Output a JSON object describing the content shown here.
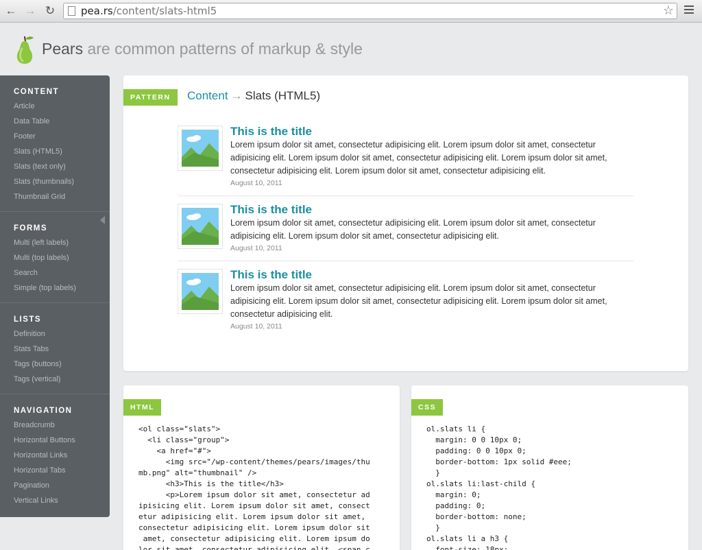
{
  "browser": {
    "url_domain": "pea.rs",
    "url_path": "/content/slats-html5"
  },
  "header": {
    "brand": "Pears",
    "tagline": " are common patterns of markup & style"
  },
  "sidebar": {
    "sections": [
      {
        "heading": "CONTENT",
        "items": [
          "Article",
          "Data Table",
          "Footer",
          "Slats (HTML5)",
          "Slats (text only)",
          "Slats (thumbnails)",
          "Thumbnail Grid"
        ]
      },
      {
        "heading": "FORMS",
        "items": [
          "Multi (left labels)",
          "Multi (top labels)",
          "Search",
          "Simple (top labels)"
        ]
      },
      {
        "heading": "LISTS",
        "items": [
          "Definition",
          "Stats Tabs",
          "Tags (buttons)",
          "Tags (vertical)"
        ]
      },
      {
        "heading": "NAVIGATION",
        "items": [
          "Breadcrumb",
          "Horizontal Buttons",
          "Horizontal Links",
          "Horizontal Tabs",
          "Pagination",
          "Vertical Links"
        ]
      }
    ]
  },
  "pattern": {
    "tag": "PATTERN",
    "breadcrumb_link": "Content",
    "breadcrumb_arrow": "→",
    "breadcrumb_current": "Slats (HTML5)",
    "slats": [
      {
        "title": "This is the title",
        "text": "Lorem ipsum dolor sit amet, consectetur adipisicing elit. Lorem ipsum dolor sit amet, consectetur adipisicing elit. Lorem ipsum dolor sit amet, consectetur adipisicing elit. Lorem ipsum dolor sit amet, consectetur adipisicing elit. Lorem ipsum dolor sit amet, consectetur adipisicing elit.",
        "date": "August 10, 2011"
      },
      {
        "title": "This is the title",
        "text": "Lorem ipsum dolor sit amet, consectetur adipisicing elit. Lorem ipsum dolor sit amet, consectetur adipisicing elit. Lorem ipsum dolor sit amet, consectetur adipisicing elit.",
        "date": "August 10, 2011"
      },
      {
        "title": "This is the title",
        "text": "Lorem ipsum dolor sit amet, consectetur adipisicing elit. Lorem ipsum dolor sit amet, consectetur adipisicing elit. Lorem ipsum dolor sit amet, consectetur adipisicing elit. Lorem ipsum dolor sit amet, consectetur adipisicing elit.",
        "date": "August 10, 2011"
      }
    ]
  },
  "html_panel": {
    "tag": "HTML",
    "code": "<ol class=\"slats\">\n  <li class=\"group\">\n    <a href=\"#\">\n      <img src=\"/wp-content/themes/pears/images/thu\nmb.png\" alt=\"thumbnail\" />\n      <h3>This is the title</h3>\n      <p>Lorem ipsum dolor sit amet, consectetur ad\nipisicing elit. Lorem ipsum dolor sit amet, consect\netur adipisicing elit. Lorem ipsum dolor sit amet,\nconsectetur adipisicing elit. Lorem ipsum dolor sit\n amet, consectetur adipisicing elit. Lorem ipsum do\nlor sit amet, consectetur adipisicing elit. <span c"
  },
  "css_panel": {
    "tag": "CSS",
    "code": "ol.slats li {\n  margin: 0 0 10px 0;\n  padding: 0 0 10px 0;\n  border-bottom: 1px solid #eee;\n  }\nol.slats li:last-child {\n  margin: 0;\n  padding: 0;\n  border-bottom: none;\n  }\nol.slats li a h3 {\n  font-size: 18px;"
  },
  "colors": {
    "accent_green": "#8dc63f",
    "link_teal": "#1a8fa0",
    "sidebar_bg": "#5a5f63"
  }
}
